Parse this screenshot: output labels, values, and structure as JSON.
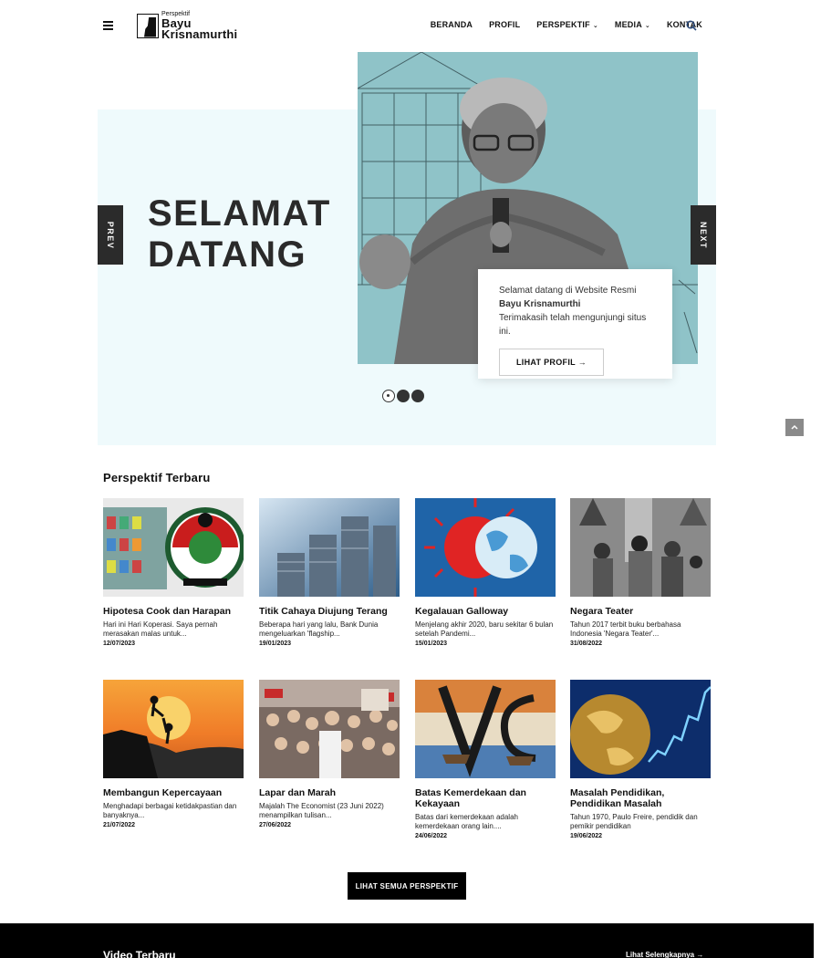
{
  "header": {
    "logo_small": "Perspektif",
    "logo_line1": "Bayu",
    "logo_line2": "Krisnamurthi",
    "nav": [
      {
        "label": "BERANDA",
        "dropdown": false
      },
      {
        "label": "PROFIL",
        "dropdown": false
      },
      {
        "label": "PERSPEKTIF",
        "dropdown": true
      },
      {
        "label": "MEDIA",
        "dropdown": true
      },
      {
        "label": "KONTAK",
        "dropdown": false
      }
    ]
  },
  "hero": {
    "title_line1": "SELAMAT",
    "title_line2": "DATANG",
    "prev_label": "PREV",
    "next_label": "NEXT",
    "card_text1": "Selamat datang di Website Resmi",
    "card_name": "Bayu Krisnamurthi",
    "card_text2": "Terimakasih telah mengunjungi situs ini.",
    "profile_button": "LIHAT PROFIL →",
    "slides_count": 3,
    "active_slide": 1
  },
  "section": {
    "title": "Perspektif Terbaru",
    "all_button": "LIHAT SEMUA PERSPEKTIF"
  },
  "articles": [
    {
      "title": "Hipotesa Cook dan Harapan",
      "excerpt": "Hari ini Hari Koperasi. Saya pernah merasakan malas untuk...",
      "date": "12/07/2023"
    },
    {
      "title": "Titik Cahaya Diujung Terang",
      "excerpt": "Beberapa hari yang lalu, Bank Dunia mengeluarkan 'flagship...",
      "date": "19/01/2023"
    },
    {
      "title": "Kegalauan Galloway",
      "excerpt": "Menjelang akhir 2020, baru sekitar 6 bulan setelah Pandemi...",
      "date": "15/01/2023"
    },
    {
      "title": "Negara Teater",
      "excerpt": "Tahun 2017 terbit buku berbahasa Indonesia 'Negara Teater'...",
      "date": "31/08/2022"
    },
    {
      "title": "Membangun Kepercayaan",
      "excerpt": "Menghadapi berbagai ketidakpastian dan banyaknya...",
      "date": "21/07/2022"
    },
    {
      "title": "Lapar dan Marah",
      "excerpt": "Majalah The Economist (23 Juni 2022) menampilkan tulisan...",
      "date": "27/06/2022"
    },
    {
      "title": "Batas Kemerdekaan dan Kekayaan",
      "excerpt": "Batas dari kemerdekaan adalah kemerdekaan orang lain....",
      "date": "24/06/2022"
    },
    {
      "title": "Masalah Pendidikan, Pendidikan Masalah",
      "excerpt": "Tahun 1970, Paulo Freire, pendidik dan pemikir pendidikan",
      "date": "19/06/2022"
    }
  ],
  "footer": {
    "video_title": "Video Terbaru",
    "more_link": "Lihat Selengkapnya →"
  },
  "colors": {
    "hero_bg": "#effafc",
    "photo_bg": "#8fc3c8",
    "dark": "#2b2b2b"
  }
}
